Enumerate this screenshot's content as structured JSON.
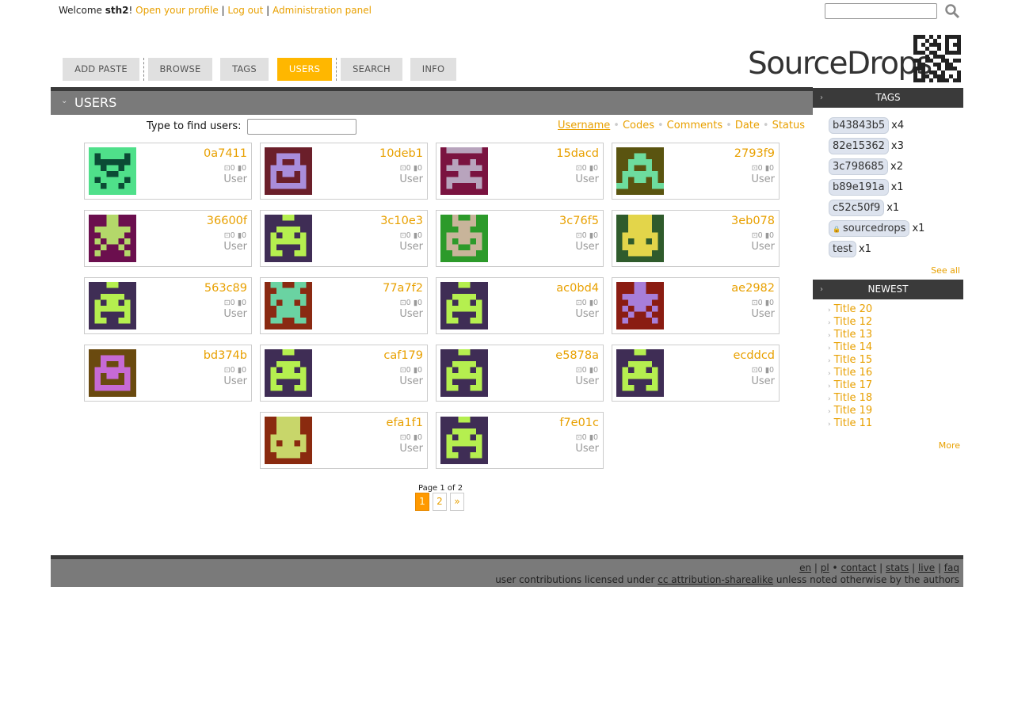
{
  "header": {
    "welcome": "Welcome",
    "username": "sth2",
    "exclaim": "!",
    "open_profile": "Open your profile",
    "logout": "Log out",
    "admin": "Administration panel",
    "sep": "|"
  },
  "nav": [
    "ADD PASTE",
    "BROWSE",
    "TAGS",
    "USERS",
    "SEARCH",
    "INFO"
  ],
  "nav_active": "USERS",
  "logo": "SourceDrops",
  "main": {
    "title": "USERS",
    "finder_label": "Type to find users:",
    "sort": [
      "Username",
      "Codes",
      "Comments",
      "Date",
      "Status"
    ],
    "sort_selected": "Username"
  },
  "users": [
    {
      "name": "0a7411",
      "codes": "0",
      "comments": "0",
      "role": "User",
      "bg": "#0b4b35",
      "fg": "#4fe08a"
    },
    {
      "name": "10deb1",
      "codes": "0",
      "comments": "0",
      "role": "User",
      "bg": "#6b1f2a",
      "fg": "#a98ddb"
    },
    {
      "name": "15dacd",
      "codes": "0",
      "comments": "0",
      "role": "User",
      "bg": "#7a1340",
      "fg": "#b8a4bd"
    },
    {
      "name": "2793f9",
      "codes": "0",
      "comments": "0",
      "role": "User",
      "bg": "#5a5410",
      "fg": "#6ddc9e"
    },
    {
      "name": "36600f",
      "codes": "0",
      "comments": "0",
      "role": "User",
      "bg": "#6b0f4e",
      "fg": "#b4d86a"
    },
    {
      "name": "3c10e3",
      "codes": "0",
      "comments": "0",
      "role": "User",
      "bg": "#3f2d55",
      "fg": "#b5ef4f"
    },
    {
      "name": "3c76f5",
      "codes": "0",
      "comments": "0",
      "role": "User",
      "bg": "#2c9a2a",
      "fg": "#c8b49a"
    },
    {
      "name": "3eb078",
      "codes": "0",
      "comments": "0",
      "role": "User",
      "bg": "#2f5b2c",
      "fg": "#e3d54a"
    },
    {
      "name": "563c89",
      "codes": "0",
      "comments": "0",
      "role": "User",
      "bg": "#3f2d55",
      "fg": "#b5ef4f"
    },
    {
      "name": "77a7f2",
      "codes": "0",
      "comments": "0",
      "role": "User",
      "bg": "#8a2a12",
      "fg": "#6ad3a2"
    },
    {
      "name": "ac0bd4",
      "codes": "0",
      "comments": "0",
      "role": "User",
      "bg": "#3f2d55",
      "fg": "#b5ef4f"
    },
    {
      "name": "ae2982",
      "codes": "0",
      "comments": "0",
      "role": "User",
      "bg": "#8a1c12",
      "fg": "#a77ed9"
    },
    {
      "name": "bd374b",
      "codes": "0",
      "comments": "0",
      "role": "User",
      "bg": "#6a4a0f",
      "fg": "#c66ad5"
    },
    {
      "name": "caf179",
      "codes": "0",
      "comments": "0",
      "role": "User",
      "bg": "#3f2d55",
      "fg": "#b5ef4f"
    },
    {
      "name": "e5878a",
      "codes": "0",
      "comments": "0",
      "role": "User",
      "bg": "#3f2d55",
      "fg": "#b5ef4f"
    },
    {
      "name": "ecddcd",
      "codes": "0",
      "comments": "0",
      "role": "User",
      "bg": "#3f2d55",
      "fg": "#b5ef4f"
    },
    {
      "name": "efa1f1",
      "codes": "0",
      "comments": "0",
      "role": "User",
      "bg": "#8a2a0f",
      "fg": "#c8d66a"
    },
    {
      "name": "f7e01c",
      "codes": "0",
      "comments": "0",
      "role": "User",
      "bg": "#3f2d55",
      "fg": "#b5ef4f"
    }
  ],
  "pager": {
    "label": "Page 1 of 2",
    "pages": [
      "1",
      "2"
    ],
    "next": "»",
    "current": "1"
  },
  "sidebar": {
    "tags_title": "TAGS",
    "tags": [
      {
        "name": "b43843b5",
        "count": "x4",
        "locked": false
      },
      {
        "name": "82e15362",
        "count": "x3",
        "locked": false
      },
      {
        "name": "3c798685",
        "count": "x2",
        "locked": false
      },
      {
        "name": "b89e191a",
        "count": "x1",
        "locked": false
      },
      {
        "name": "c52c50f9",
        "count": "x1",
        "locked": false
      },
      {
        "name": "sourcedrops",
        "count": "x1",
        "locked": true
      },
      {
        "name": "test",
        "count": "x1",
        "locked": false
      }
    ],
    "see_all": "See all",
    "newest_title": "NEWEST",
    "newest": [
      "Title 20",
      "Title 12",
      "Title 13",
      "Title 14",
      "Title 15",
      "Title 16",
      "Title 17",
      "Title 18",
      "Title 19",
      "Title 11"
    ],
    "more": "More"
  },
  "footer": {
    "langs": [
      "en",
      "pl"
    ],
    "links": [
      "contact",
      "stats",
      "live",
      "faq"
    ],
    "license_pre": "user contributions licensed under",
    "license_link": "cc attribution-sharealike",
    "license_post": "unless noted otherwise by the authors"
  },
  "colors": {
    "accent": "#ffb700",
    "link": "#e8a000",
    "bar_dark": "#3a3a3a",
    "bar_gray": "#7a7a7a"
  }
}
